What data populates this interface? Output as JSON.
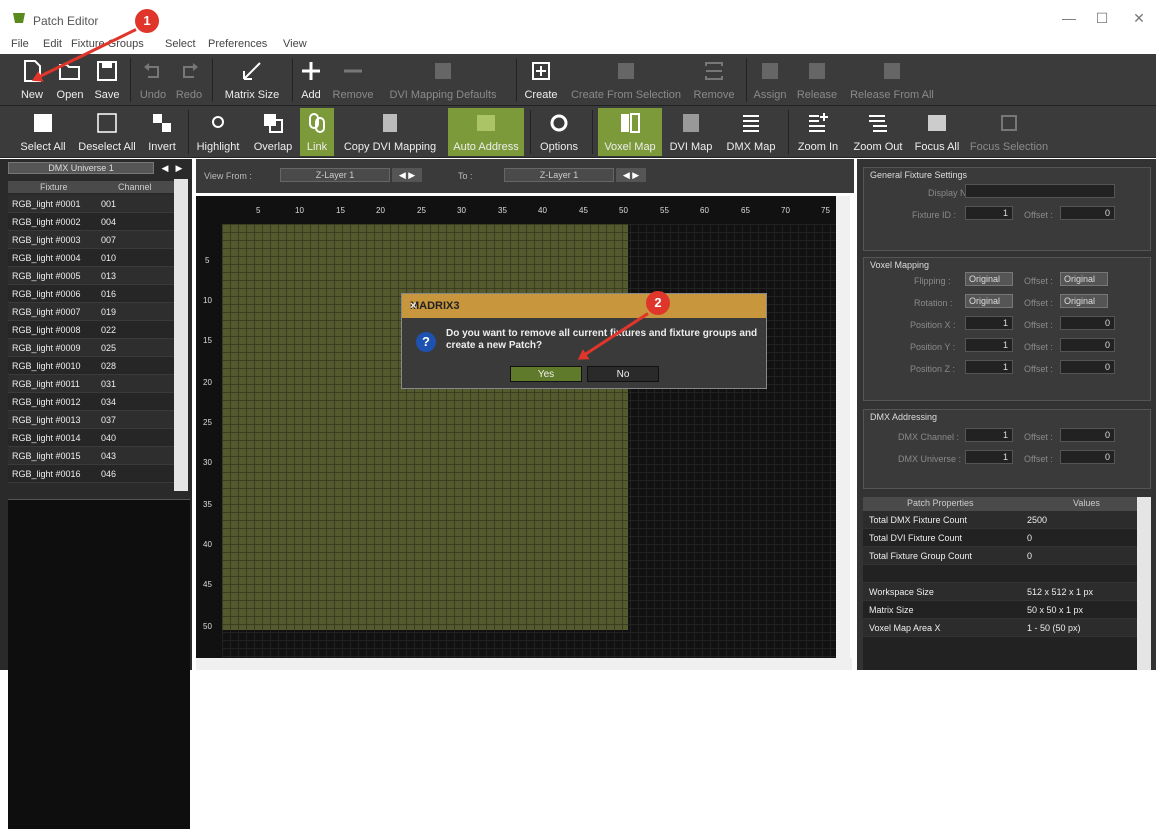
{
  "window": {
    "title": "Patch Editor",
    "minimize": "—",
    "maximize": "☐",
    "close": "✕"
  },
  "menu": [
    "File",
    "Edit",
    "Fixture Groups",
    "Select",
    "Preferences",
    "View"
  ],
  "toolbar1": [
    {
      "label": "New",
      "icon": "new-file-icon"
    },
    {
      "label": "Open",
      "icon": "folder-icon"
    },
    {
      "label": "Save",
      "icon": "save-icon"
    },
    {
      "label": "Undo",
      "icon": "undo-icon"
    },
    {
      "label": "Redo",
      "icon": "redo-icon"
    },
    {
      "label": "Matrix Size",
      "icon": "matrix-size-icon"
    },
    {
      "label": "Add",
      "icon": "plus-icon"
    },
    {
      "label": "Remove",
      "icon": "minus-icon"
    },
    {
      "label": "DVI Mapping Defaults",
      "icon": "dvi-icon"
    },
    {
      "label": "Create",
      "icon": "create-icon"
    },
    {
      "label": "Create From Selection",
      "icon": "create-selection-icon"
    },
    {
      "label": "Remove",
      "icon": "remove-group-icon"
    },
    {
      "label": "Assign",
      "icon": "assign-icon"
    },
    {
      "label": "Release",
      "icon": "release-icon"
    },
    {
      "label": "Release From All",
      "icon": "release-all-icon"
    }
  ],
  "toolbar2": [
    {
      "label": "Select All",
      "icon": "select-all-icon"
    },
    {
      "label": "Deselect All",
      "icon": "deselect-all-icon"
    },
    {
      "label": "Invert",
      "icon": "invert-icon"
    },
    {
      "label": "Highlight",
      "icon": "highlight-icon"
    },
    {
      "label": "Overlap",
      "icon": "overlap-icon"
    },
    {
      "label": "Link",
      "icon": "link-icon"
    },
    {
      "label": "Copy DVI Mapping",
      "icon": "copy-dvi-icon"
    },
    {
      "label": "Auto Address",
      "icon": "auto-address-icon"
    },
    {
      "label": "Options",
      "icon": "gear-icon"
    },
    {
      "label": "Voxel Map",
      "icon": "voxel-map-icon"
    },
    {
      "label": "DVI Map",
      "icon": "dvi-map-icon"
    },
    {
      "label": "DMX Map",
      "icon": "dmx-map-icon"
    },
    {
      "label": "Zoom In",
      "icon": "zoom-in-icon"
    },
    {
      "label": "Zoom Out",
      "icon": "zoom-out-icon"
    },
    {
      "label": "Focus All",
      "icon": "focus-all-icon"
    },
    {
      "label": "Focus Selection",
      "icon": "focus-selection-icon"
    }
  ],
  "left": {
    "universe": "DMX Universe 1",
    "col_fixture": "Fixture",
    "col_channel": "Channel",
    "rows": [
      {
        "f": "RGB_light #0001",
        "c": "001"
      },
      {
        "f": "RGB_light #0002",
        "c": "004"
      },
      {
        "f": "RGB_light #0003",
        "c": "007"
      },
      {
        "f": "RGB_light #0004",
        "c": "010"
      },
      {
        "f": "RGB_light #0005",
        "c": "013"
      },
      {
        "f": "RGB_light #0006",
        "c": "016"
      },
      {
        "f": "RGB_light #0007",
        "c": "019"
      },
      {
        "f": "RGB_light #0008",
        "c": "022"
      },
      {
        "f": "RGB_light #0009",
        "c": "025"
      },
      {
        "f": "RGB_light #0010",
        "c": "028"
      },
      {
        "f": "RGB_light #0011",
        "c": "031"
      },
      {
        "f": "RGB_light #0012",
        "c": "034"
      },
      {
        "f": "RGB_light #0013",
        "c": "037"
      },
      {
        "f": "RGB_light #0014",
        "c": "040"
      },
      {
        "f": "RGB_light #0015",
        "c": "043"
      },
      {
        "f": "RGB_light #0016",
        "c": "046"
      }
    ]
  },
  "view": {
    "from_label": "View From :",
    "from_value": "Z-Layer 1",
    "to_label": "To :",
    "to_value": "Z-Layer 1"
  },
  "ruler": {
    "top": [
      "5",
      "10",
      "15",
      "20",
      "25",
      "30",
      "35",
      "40",
      "45",
      "50",
      "55",
      "60",
      "65",
      "70",
      "75"
    ],
    "left": [
      "5",
      "10",
      "15",
      "20",
      "25",
      "30",
      "35",
      "40",
      "45",
      "50"
    ]
  },
  "dialog": {
    "title": "MADRIX3",
    "message": "Do you want to remove all current fixtures and fixture groups and create a new Patch?",
    "yes": "Yes",
    "no": "No",
    "close": "×"
  },
  "callouts": {
    "one": "1",
    "two": "2"
  },
  "right": {
    "general": {
      "title": "General Fixture Settings",
      "display_name": "Display Name :",
      "fixture_id": "Fixture ID :",
      "fixture_id_val": "1",
      "offset": "Offset :",
      "offset_val": "0"
    },
    "voxel": {
      "title": "Voxel Mapping",
      "flipping": "Flipping :",
      "rotation": "Rotation :",
      "pos_x": "Position X :",
      "pos_y": "Position Y :",
      "pos_z": "Position Z :",
      "original": "Original",
      "one": "1",
      "zero": "0",
      "offset": "Offset :"
    },
    "dmx": {
      "title": "DMX Addressing",
      "channel": "DMX Channel :",
      "universe": "DMX Universe :",
      "one": "1",
      "zero": "0",
      "offset": "Offset :"
    },
    "props": {
      "col1": "Patch Properties",
      "col2": "Values",
      "rows": [
        {
          "k": "Total DMX Fixture Count",
          "v": "2500"
        },
        {
          "k": "Total DVI Fixture Count",
          "v": "0"
        },
        {
          "k": "Total Fixture Group Count",
          "v": "0"
        },
        {
          "k": "",
          "v": ""
        },
        {
          "k": "Workspace Size",
          "v": "512 x 512 x 1 px"
        },
        {
          "k": "Matrix Size",
          "v": "50 x 50 x 1 px"
        },
        {
          "k": "Voxel Map Area X",
          "v": "1 - 50 (50 px)"
        }
      ]
    }
  },
  "colors": {
    "accent": "#7c9a3a",
    "callout": "#e0352b",
    "dialog_title": "#c8963c",
    "grid_fill": "#555a2e"
  }
}
